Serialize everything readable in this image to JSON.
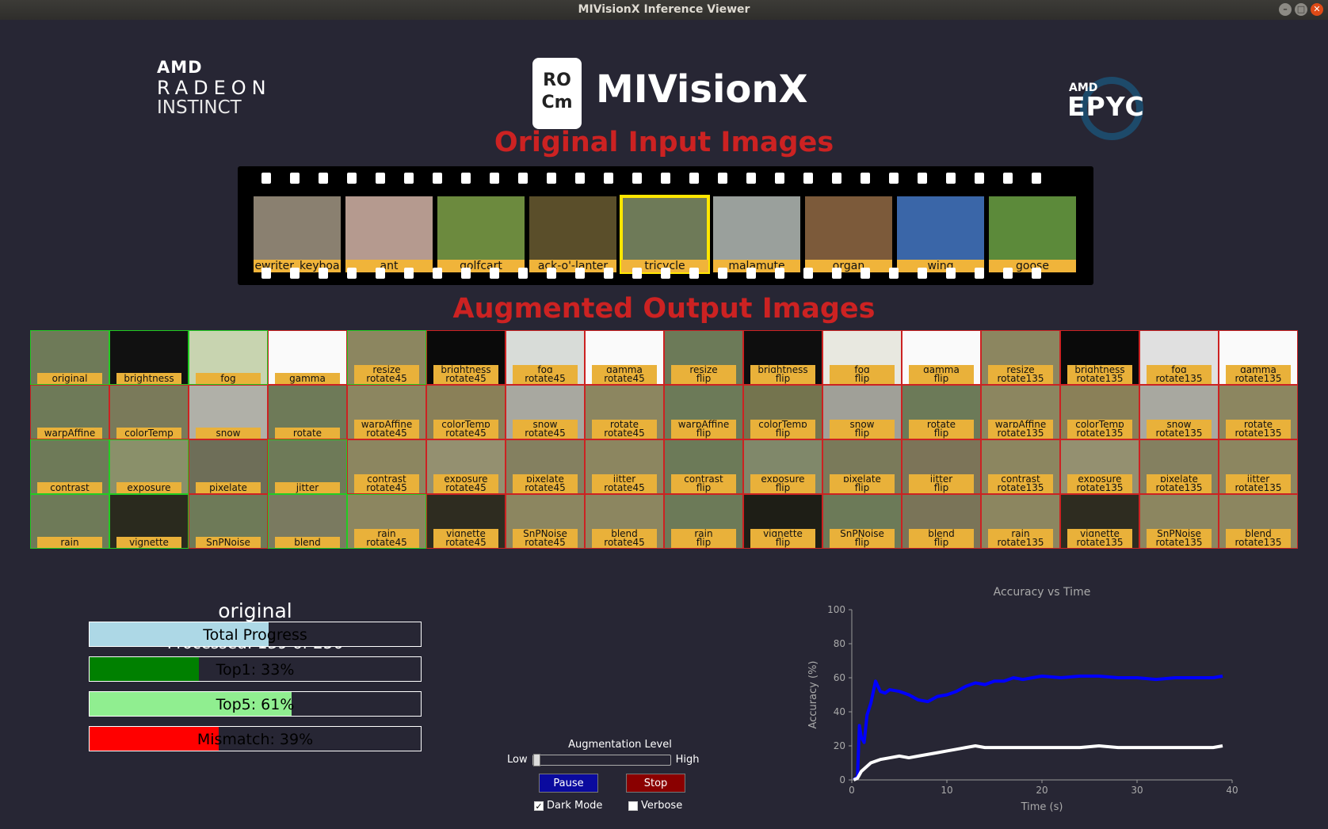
{
  "window": {
    "title": "MIVisionX Inference Viewer"
  },
  "logos": {
    "amd_left": {
      "brand": "AMD",
      "line2": "RADEON",
      "line3": "INSTINCT"
    },
    "rocm": "RO Cm",
    "mivisionx": "MIVisionX",
    "epyc": {
      "brand": "AMD",
      "name": "EPYC"
    }
  },
  "headings": {
    "input": "Original Input Images",
    "output": "Augmented Output Images"
  },
  "input_images": [
    {
      "label": "ewriter_keyboa",
      "color": "#8a8070"
    },
    {
      "label": "ant",
      "color": "#b59a8f"
    },
    {
      "label": "golfcart",
      "color": "#6c8a3e"
    },
    {
      "label": "ack-o'-lanter",
      "color": "#5a4e2a"
    },
    {
      "label": "tricycle",
      "color": "#6e7a58",
      "selected": true
    },
    {
      "label": "malamute",
      "color": "#9aa09c"
    },
    {
      "label": "organ",
      "color": "#7c5a3a"
    },
    {
      "label": "wing",
      "color": "#3a66a8"
    },
    {
      "label": "goose",
      "color": "#5c8a3a"
    }
  ],
  "augmented": [
    {
      "l1": "original",
      "l2": "",
      "ok": true,
      "bg": "#6e7a58"
    },
    {
      "l1": "brightness",
      "l2": "",
      "ok": true,
      "bg": "#111111"
    },
    {
      "l1": "fog",
      "l2": "",
      "ok": true,
      "bg": "#c8d4b0"
    },
    {
      "l1": "gamma",
      "l2": "",
      "ok": false,
      "bg": "#fafafa"
    },
    {
      "l1": "rotate45",
      "l2": "resize",
      "ok": true,
      "bg": "#8c8660"
    },
    {
      "l1": "rotate45",
      "l2": "brightness",
      "ok": false,
      "bg": "#0a0a0a"
    },
    {
      "l1": "rotate45",
      "l2": "fog",
      "ok": false,
      "bg": "#d8dcd8"
    },
    {
      "l1": "rotate45",
      "l2": "gamma",
      "ok": false,
      "bg": "#fafafa"
    },
    {
      "l1": "flip",
      "l2": "resize",
      "ok": false,
      "bg": "#6c7a58"
    },
    {
      "l1": "flip",
      "l2": "brightness",
      "ok": false,
      "bg": "#0e0e0e"
    },
    {
      "l1": "flip",
      "l2": "fog",
      "ok": false,
      "bg": "#e8e8e0"
    },
    {
      "l1": "flip",
      "l2": "gamma",
      "ok": false,
      "bg": "#fafafa"
    },
    {
      "l1": "rotate135",
      "l2": "resize",
      "ok": false,
      "bg": "#8c8660"
    },
    {
      "l1": "rotate135",
      "l2": "brightness",
      "ok": false,
      "bg": "#0a0a0a"
    },
    {
      "l1": "rotate135",
      "l2": "fog",
      "ok": false,
      "bg": "#e0e0e0"
    },
    {
      "l1": "rotate135",
      "l2": "gamma",
      "ok": false,
      "bg": "#fafafa"
    },
    {
      "l1": "warpAffine",
      "l2": "",
      "ok": false,
      "bg": "#6e7a58"
    },
    {
      "l1": "colorTemp",
      "l2": "",
      "ok": false,
      "bg": "#7a7a5a"
    },
    {
      "l1": "snow",
      "l2": "",
      "ok": false,
      "bg": "#b0b0a8"
    },
    {
      "l1": "rotate",
      "l2": "",
      "ok": false,
      "bg": "#6e7a58"
    },
    {
      "l1": "rotate45",
      "l2": "warpAffine",
      "ok": false,
      "bg": "#8c8660"
    },
    {
      "l1": "rotate45",
      "l2": "colorTemp",
      "ok": false,
      "bg": "#8a8058"
    },
    {
      "l1": "rotate45",
      "l2": "snow",
      "ok": false,
      "bg": "#a8a8a0"
    },
    {
      "l1": "rotate45",
      "l2": "rotate",
      "ok": false,
      "bg": "#8c8660"
    },
    {
      "l1": "flip",
      "l2": "warpAffine",
      "ok": false,
      "bg": "#6c7a58"
    },
    {
      "l1": "flip",
      "l2": "colorTemp",
      "ok": false,
      "bg": "#74744e"
    },
    {
      "l1": "flip",
      "l2": "snow",
      "ok": false,
      "bg": "#a0a098"
    },
    {
      "l1": "flip",
      "l2": "rotate",
      "ok": false,
      "bg": "#6c7a58"
    },
    {
      "l1": "rotate135",
      "l2": "warpAffine",
      "ok": false,
      "bg": "#8c8660"
    },
    {
      "l1": "rotate135",
      "l2": "colorTemp",
      "ok": false,
      "bg": "#8a8058"
    },
    {
      "l1": "rotate135",
      "l2": "snow",
      "ok": false,
      "bg": "#a8a8a0"
    },
    {
      "l1": "rotate135",
      "l2": "rotate",
      "ok": false,
      "bg": "#8c8660"
    },
    {
      "l1": "contrast",
      "l2": "",
      "ok": true,
      "bg": "#6e7a58"
    },
    {
      "l1": "exposure",
      "l2": "",
      "ok": true,
      "bg": "#8a906a"
    },
    {
      "l1": "pixelate",
      "l2": "",
      "ok": false,
      "bg": "#6e6e58"
    },
    {
      "l1": "jitter",
      "l2": "",
      "ok": true,
      "bg": "#6e7a58"
    },
    {
      "l1": "rotate45",
      "l2": "contrast",
      "ok": false,
      "bg": "#8c8660"
    },
    {
      "l1": "rotate45",
      "l2": "exposure",
      "ok": false,
      "bg": "#949070"
    },
    {
      "l1": "rotate45",
      "l2": "pixelate",
      "ok": false,
      "bg": "#848060"
    },
    {
      "l1": "rotate45",
      "l2": "jitter",
      "ok": false,
      "bg": "#8c8660"
    },
    {
      "l1": "flip",
      "l2": "contrast",
      "ok": false,
      "bg": "#6c7a58"
    },
    {
      "l1": "flip",
      "l2": "exposure",
      "ok": false,
      "bg": "#80886a"
    },
    {
      "l1": "flip",
      "l2": "pixelate",
      "ok": false,
      "bg": "#7a7a5a"
    },
    {
      "l1": "flip",
      "l2": "jitter",
      "ok": false,
      "bg": "#7c7458"
    },
    {
      "l1": "rotate135",
      "l2": "contrast",
      "ok": false,
      "bg": "#8c8660"
    },
    {
      "l1": "rotate135",
      "l2": "exposure",
      "ok": false,
      "bg": "#949070"
    },
    {
      "l1": "rotate135",
      "l2": "pixelate",
      "ok": false,
      "bg": "#848060"
    },
    {
      "l1": "rotate135",
      "l2": "jitter",
      "ok": false,
      "bg": "#8c8660"
    },
    {
      "l1": "rain",
      "l2": "",
      "ok": true,
      "bg": "#6e7a58"
    },
    {
      "l1": "vignette",
      "l2": "",
      "ok": true,
      "bg": "#2a2a1e"
    },
    {
      "l1": "SnPNoise",
      "l2": "",
      "ok": false,
      "bg": "#6e7a58"
    },
    {
      "l1": "blend",
      "l2": "",
      "ok": true,
      "bg": "#7a7a60"
    },
    {
      "l1": "rotate45",
      "l2": "rain",
      "ok": true,
      "bg": "#8c8660"
    },
    {
      "l1": "rotate45",
      "l2": "vignette",
      "ok": false,
      "bg": "#2e2c20"
    },
    {
      "l1": "rotate45",
      "l2": "SnPNoise",
      "ok": false,
      "bg": "#8c8660"
    },
    {
      "l1": "rotate45",
      "l2": "blend",
      "ok": false,
      "bg": "#8c8660"
    },
    {
      "l1": "flip",
      "l2": "rain",
      "ok": false,
      "bg": "#6c7a58"
    },
    {
      "l1": "flip",
      "l2": "vignette",
      "ok": false,
      "bg": "#1e1e16"
    },
    {
      "l1": "flip",
      "l2": "SnPNoise",
      "ok": false,
      "bg": "#6c7a58"
    },
    {
      "l1": "flip",
      "l2": "blend",
      "ok": false,
      "bg": "#7a7458"
    },
    {
      "l1": "rotate135",
      "l2": "rain",
      "ok": false,
      "bg": "#8c8660"
    },
    {
      "l1": "rotate135",
      "l2": "vignette",
      "ok": false,
      "bg": "#2e2c20"
    },
    {
      "l1": "rotate135",
      "l2": "SnPNoise",
      "ok": false,
      "bg": "#8c8660"
    },
    {
      "l1": "rotate135",
      "l2": "blend",
      "ok": false,
      "bg": "#8c8660"
    }
  ],
  "status": {
    "current": "original",
    "processed": "Processed: 139 of 256"
  },
  "bars": [
    {
      "label": "Total Progress",
      "value": 0.54,
      "color": "#add8e6"
    },
    {
      "label": "Top1: 33%",
      "value": 0.33,
      "color": "#008000"
    },
    {
      "label": "Top5: 61%",
      "value": 0.61,
      "color": "#90ee90"
    },
    {
      "label": "Mismatch: 39%",
      "value": 0.39,
      "color": "#ff0000"
    }
  ],
  "controls": {
    "aug_title": "Augmentation Level",
    "low": "Low",
    "high": "High",
    "level": 0,
    "pause": "Pause",
    "stop": "Stop",
    "dark_mode": {
      "label": "Dark Mode",
      "checked": true
    },
    "verbose": {
      "label": "Verbose",
      "checked": false
    }
  },
  "chart_data": {
    "type": "line",
    "title": "Accuracy vs Time",
    "xlabel": "Time (s)",
    "ylabel": "Accuracy (%)",
    "xlim": [
      0,
      40
    ],
    "ylim": [
      0,
      100
    ],
    "xticks": [
      0,
      10,
      20,
      30,
      40
    ],
    "yticks": [
      0,
      20,
      40,
      60,
      80,
      100
    ],
    "series": [
      {
        "color": "#0000ff",
        "x": [
          0.2,
          0.6,
          0.8,
          1.0,
          1.3,
          1.6,
          2.0,
          2.5,
          3.0,
          3.5,
          4.0,
          5.0,
          6.0,
          7.0,
          8.0,
          9.0,
          10.0,
          11.0,
          12.0,
          13.0,
          14.0,
          15.0,
          16.0,
          17.0,
          18.0,
          20.0,
          22.0,
          24.0,
          26.0,
          28.0,
          30.0,
          32.0,
          34.0,
          36.0,
          38.0,
          39.0
        ],
        "y": [
          0,
          2,
          32,
          25,
          22,
          38,
          45,
          58,
          52,
          51,
          53,
          52,
          50,
          47,
          46,
          49,
          50,
          52,
          55,
          57,
          56,
          58,
          58,
          60,
          59,
          61,
          60,
          61,
          61,
          60,
          60,
          59,
          60,
          60,
          60,
          61
        ]
      },
      {
        "color": "#ffffff",
        "x": [
          0.2,
          0.6,
          1.0,
          2.0,
          3.0,
          4.0,
          5.0,
          6.0,
          7.0,
          8.0,
          9.0,
          10.0,
          11.0,
          12.0,
          13.0,
          14.0,
          16.0,
          18.0,
          20.0,
          22.0,
          24.0,
          26.0,
          28.0,
          30.0,
          32.0,
          34.0,
          36.0,
          38.0,
          39.0
        ],
        "y": [
          0,
          1,
          5,
          10,
          12,
          13,
          14,
          13,
          14,
          15,
          16,
          17,
          18,
          19,
          20,
          19,
          19,
          19,
          19,
          19,
          19,
          20,
          19,
          19,
          19,
          19,
          19,
          19,
          20
        ]
      }
    ]
  }
}
